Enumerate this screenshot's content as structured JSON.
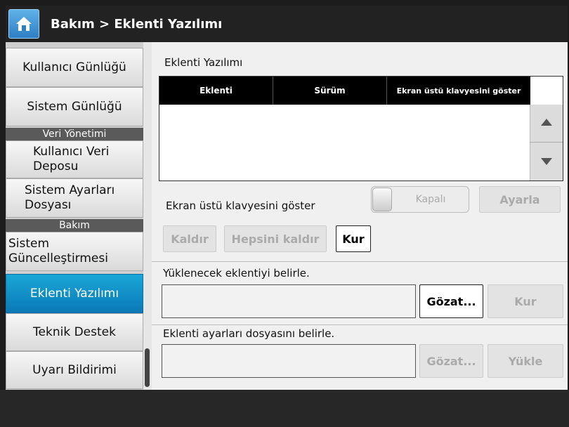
{
  "titlebar": {
    "title": "Bakım > Eklenti Yazılımı",
    "home_icon": "home-icon"
  },
  "sidebar": {
    "item_user_log": "Kullanıcı Günlüğü",
    "item_system_log": "Sistem Günlüğü",
    "header_data_mgmt": "Veri Yönetimi",
    "item_user_data_line1": "Kullanıcı Veri",
    "item_user_data_line2": "Deposu",
    "item_settings_file_line1": "Sistem Ayarları",
    "item_settings_file_line2": "Dosyası",
    "header_maintenance": "Bakım",
    "item_system_update_line1": "Sistem",
    "item_system_update_line2": "Güncelleştirmesi",
    "item_addon": "Eklenti Yazılımı",
    "item_tech_support": "Teknik Destek",
    "item_alert": "Uyarı Bildirimi",
    "active_color": "#0a8fc8"
  },
  "main": {
    "section_title": "Eklenti Yazılımı",
    "table": {
      "columns": [
        "Eklenti",
        "Sürüm",
        "Ekran üstü klavyesini göster"
      ],
      "rows": []
    },
    "keyboard_label": "Ekran üstü klavyesini göster",
    "toggle_state": "Kapalı",
    "configure_button": "Ayarla",
    "remove_button": "Kaldır",
    "remove_all_button": "Hepsini kaldır",
    "install_button": "Kur",
    "upload_label": "Yüklenecek eklentiyi belirle.",
    "upload_value": "",
    "browse_button": "Gözat...",
    "upload_install_button": "Kur",
    "settings_label": "Eklenti ayarları dosyasını belirle.",
    "settings_value": "",
    "settings_browse_button": "Gözat...",
    "load_button": "Yükle"
  }
}
